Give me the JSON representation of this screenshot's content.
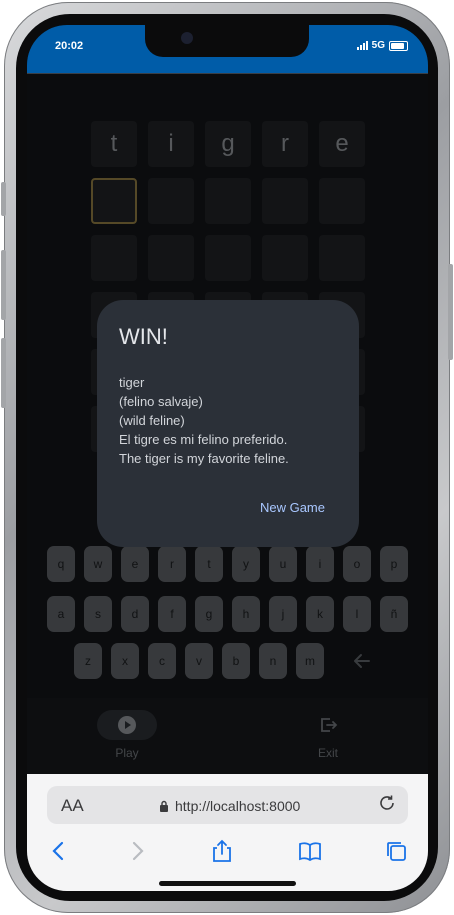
{
  "status_bar": {
    "time": "20:02",
    "network": "5G"
  },
  "board": {
    "rows": [
      [
        "t",
        "i",
        "g",
        "r",
        "e"
      ],
      [
        "",
        "",
        "",
        "",
        ""
      ],
      [
        "",
        "",
        "",
        "",
        ""
      ],
      [
        "",
        "",
        "",
        "",
        ""
      ],
      [
        "",
        "",
        "",
        "",
        ""
      ],
      [
        "",
        "",
        "",
        "",
        ""
      ]
    ]
  },
  "dialog": {
    "title": "WIN!",
    "lines": [
      "tiger",
      "(felino salvaje)",
      "(wild feline)",
      "El tigre es mi felino preferido.",
      "The tiger is my favorite feline."
    ],
    "button_label": "New Game"
  },
  "keyboard": {
    "row1": [
      "q",
      "w",
      "e",
      "r",
      "t",
      "y",
      "u",
      "i",
      "o",
      "p"
    ],
    "row2": [
      "a",
      "s",
      "d",
      "f",
      "g",
      "h",
      "j",
      "k",
      "l",
      "ñ"
    ],
    "row3": [
      "z",
      "x",
      "c",
      "v",
      "b",
      "n",
      "m"
    ],
    "backspace_icon": "arrow-left-icon"
  },
  "nav": {
    "play_label": "Play",
    "exit_label": "Exit"
  },
  "browser": {
    "text_size_label": "AA",
    "url": "http://localhost:8000"
  },
  "colors": {
    "status_bar": "#005ca8",
    "active_cell_border": "#8a7640",
    "dialog_button": "#a9c7ff"
  }
}
